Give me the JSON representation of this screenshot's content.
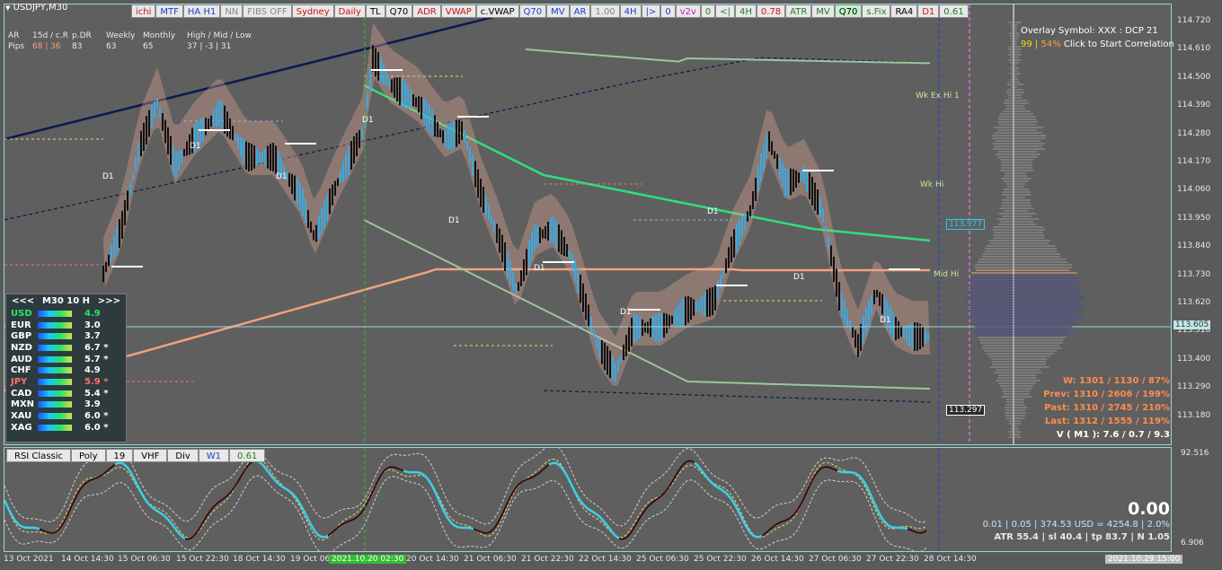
{
  "symbol": "USDJPY,M30",
  "toolbar": [
    {
      "label": "ichi",
      "style": "red"
    },
    {
      "label": "MTF",
      "style": "blue"
    },
    {
      "label": "HA H1",
      "style": "blue"
    },
    {
      "label": "NN",
      "style": "grey"
    },
    {
      "label": "FIBS OFF",
      "style": "grey"
    },
    {
      "label": "Sydney",
      "style": "red"
    },
    {
      "label": "Daily",
      "style": "red"
    },
    {
      "label": "TL",
      "style": ""
    },
    {
      "label": "Q70",
      "style": ""
    },
    {
      "label": "ADR",
      "style": "red"
    },
    {
      "label": "VWAP",
      "style": "red"
    },
    {
      "label": "c.VWAP",
      "style": ""
    },
    {
      "label": "Q70",
      "style": "blue"
    },
    {
      "label": "MV",
      "style": "blue"
    },
    {
      "label": "AR",
      "style": "blue"
    },
    {
      "label": "1.00",
      "style": "grey"
    },
    {
      "label": "4H",
      "style": "blue"
    },
    {
      "label": "|>",
      "style": "blue"
    },
    {
      "label": "0",
      "style": "blue"
    },
    {
      "label": "v2v",
      "style": "magenta"
    },
    {
      "label": "0",
      "style": "green"
    },
    {
      "label": "<|",
      "style": "green"
    },
    {
      "label": "4H",
      "style": "green"
    },
    {
      "label": "0.78",
      "style": "red"
    },
    {
      "label": "ATR",
      "style": "green"
    },
    {
      "label": "MV",
      "style": "green"
    },
    {
      "label": "Q70",
      "style": "hl"
    },
    {
      "label": "s.Fix",
      "style": "green"
    },
    {
      "label": "RA4",
      "style": ""
    },
    {
      "label": "D1",
      "style": "red"
    },
    {
      "label": "0.61",
      "style": "green"
    }
  ],
  "pips": {
    "headers": [
      "AR",
      "15d / c.R",
      "p.DR",
      "Weekly",
      "Monthly",
      "High / Mid / Low"
    ],
    "row_label": "Pips",
    "values": [
      "68 | 36",
      "83",
      "63",
      "65",
      "37 | -3 | 31"
    ]
  },
  "overlay": {
    "line1": "Overlay Symbol: XXX : DCP 21",
    "line2_a": "99",
    "line2_b": "54%",
    "line2_c": "Click to Start Correlation"
  },
  "price_axis": [
    "114.720",
    "114.610",
    "114.500",
    "114.390",
    "114.280",
    "114.170",
    "114.060",
    "113.950",
    "113.840",
    "113.730",
    "113.620",
    "113.510",
    "113.400",
    "113.290",
    "113.180"
  ],
  "price_boxes": [
    {
      "label": "113.977",
      "color": "#37c3e8"
    },
    {
      "label": "113.605",
      "color": "#bfe6e6"
    },
    {
      "label": "113.297",
      "color": "#ffffff"
    }
  ],
  "chart_labels": {
    "wk_ex_hi": "Wk Ex Hi 1",
    "wk_hi": "Wk Hi",
    "mid_hi": "Mid Hi",
    "d1": "D1"
  },
  "currency_panel": {
    "prev": "<<<",
    "title": "M30  10  H",
    "next": ">>>",
    "rows": [
      {
        "code": "USD",
        "value": "4.9",
        "color": "#29e36a",
        "mark": ""
      },
      {
        "code": "EUR",
        "value": "3.0",
        "color": "#ffffff",
        "mark": ""
      },
      {
        "code": "GBP",
        "value": "3.7",
        "color": "#ffffff",
        "mark": ""
      },
      {
        "code": "NZD",
        "value": "6.7",
        "color": "#ffffff",
        "mark": "*"
      },
      {
        "code": "AUD",
        "value": "5.7",
        "color": "#ffffff",
        "mark": "*"
      },
      {
        "code": "CHF",
        "value": "4.9",
        "color": "#ffffff",
        "mark": ""
      },
      {
        "code": "JPY",
        "value": "5.9",
        "color": "#ff7070",
        "mark": "*"
      },
      {
        "code": "CAD",
        "value": "5.4",
        "color": "#ffffff",
        "mark": "*"
      },
      {
        "code": "MXN",
        "value": "3.9",
        "color": "#ffffff",
        "mark": ""
      },
      {
        "code": "XAU",
        "value": "6.0",
        "color": "#ffffff",
        "mark": "*"
      },
      {
        "code": "XAG",
        "value": "6.0",
        "color": "#ffffff",
        "mark": "*"
      }
    ]
  },
  "stats": {
    "w": "W: 1301 / 1130 / 87%",
    "prev": "Prev: 1310 / 2606 / 199%",
    "past": "Past: 1310 / 2745 / 210%",
    "last": "Last: 1312 / 1555 / 119%",
    "v": "V ( M1 ): 7.6 / 0.7 / 9.3"
  },
  "sub_toolbar": [
    {
      "label": "RSI Classic",
      "style": ""
    },
    {
      "label": "Poly",
      "style": ""
    },
    {
      "label": "19",
      "style": ""
    },
    {
      "label": "VHF",
      "style": ""
    },
    {
      "label": "Div",
      "style": ""
    },
    {
      "label": "W1",
      "style": "blue"
    },
    {
      "label": "0.61",
      "style": "green"
    }
  ],
  "sub_info": {
    "value": "0.00",
    "line1": "0.01  |  0.05  |  374.53 USD = 4254.8  |  2.0%",
    "line2": "ATR 55.4  |  sl 40.4  |  tp 83.7  |  N 1.05"
  },
  "sub_axis": [
    "92.516",
    "6.906"
  ],
  "time_axis": [
    {
      "label": "13 Oct 2021",
      "style": ""
    },
    {
      "label": "14 Oct 14:30",
      "style": ""
    },
    {
      "label": "15 Oct 06:30",
      "style": ""
    },
    {
      "label": "15 Oct 22:30",
      "style": ""
    },
    {
      "label": "18 Oct 14:30",
      "style": ""
    },
    {
      "label": "19 Oct 06:30",
      "style": ""
    },
    {
      "label": "2021.10.20 02:30",
      "style": "hl"
    },
    {
      "label": "20 Oct 14:30",
      "style": ""
    },
    {
      "label": "21 Oct 06:30",
      "style": ""
    },
    {
      "label": "21 Oct 22:30",
      "style": ""
    },
    {
      "label": "22 Oct 14:30",
      "style": ""
    },
    {
      "label": "25 Oct 06:30",
      "style": ""
    },
    {
      "label": "25 Oct 22:30",
      "style": ""
    },
    {
      "label": "26 Oct 14:30",
      "style": ""
    },
    {
      "label": "27 Oct 06:30",
      "style": ""
    },
    {
      "label": "27 Oct 22:30",
      "style": ""
    },
    {
      "label": "28 Oct 14:30",
      "style": ""
    },
    {
      "label": "2021.10.29 15:00",
      "style": "hl2"
    }
  ],
  "colors": {
    "up": "#39a9e0",
    "down": "#111111",
    "ma_green": "#2de07a",
    "ma_salmon": "#f4a07e",
    "band": "#9cc79c",
    "navy": "#0b1a4f"
  }
}
